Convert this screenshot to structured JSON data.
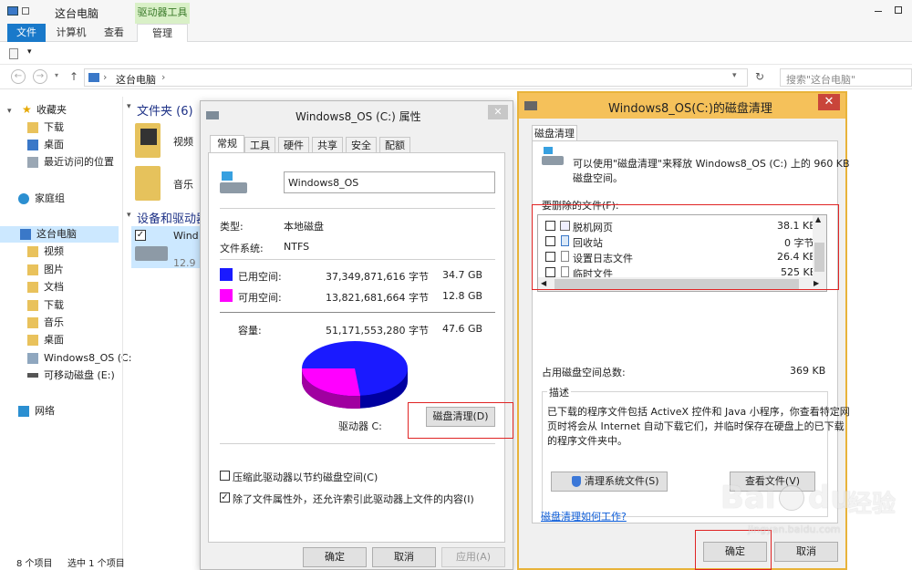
{
  "explorer": {
    "title": "这台电脑",
    "context_tab": "驱动器工具",
    "tabs": {
      "file": "文件",
      "computer": "计算机",
      "view": "查看",
      "manage": "管理"
    },
    "address_path": "这台电脑",
    "search_placeholder": "搜索\"这台电脑\"",
    "nav": {
      "favorites": "收藏夹",
      "downloads": "下载",
      "desktop": "桌面",
      "recent": "最近访问的位置",
      "homegroup": "家庭组",
      "this_pc": "这台电脑",
      "videos": "视频",
      "pictures": "图片",
      "documents": "文档",
      "downloads2": "下载",
      "music": "音乐",
      "desktop2": "桌面",
      "drive_c": "Windows8_OS (C:",
      "removable": "可移动磁盘 (E:)",
      "network": "网络"
    },
    "content": {
      "folders_header": "文件夹 (6)",
      "video_folder": "视频",
      "music_folder": "音乐",
      "devices_header": "设备和驱动器",
      "drive_name_partial": "Wind",
      "drive_size_partial": "12.9"
    },
    "status": {
      "items": "8 个项目",
      "selected": "选中 1 个项目"
    }
  },
  "properties": {
    "title": "Windows8_OS (C:) 属性",
    "tabs": [
      "常规",
      "工具",
      "硬件",
      "共享",
      "安全",
      "配额"
    ],
    "volume_name": "Windows8_OS",
    "type_label": "类型:",
    "type_value": "本地磁盘",
    "fs_label": "文件系统:",
    "fs_value": "NTFS",
    "used_label": "已用空间:",
    "used_bytes": "37,349,871,616 字节",
    "used_gb": "34.7 GB",
    "free_label": "可用空间:",
    "free_bytes": "13,821,681,664 字节",
    "free_gb": "12.8 GB",
    "capacity_label": "容量:",
    "capacity_bytes": "51,171,553,280 字节",
    "capacity_gb": "47.6 GB",
    "drive_label": "驱动器 C:",
    "cleanup_button": "磁盘清理(D)",
    "compress_label": "压缩此驱动器以节约磁盘空间(C)",
    "index_label": "除了文件属性外，还允许索引此驱动器上文件的内容(I)",
    "ok": "确定",
    "cancel": "取消",
    "apply": "应用(A)",
    "colors": {
      "used": "#1a1aff",
      "free": "#ff00ff"
    }
  },
  "cleanup": {
    "title": "Windows8_OS(C:)的磁盘清理",
    "tab": "磁盘清理",
    "intro_line1": "可以使用\"磁盘清理\"来释放 Windows8_OS (C:) 上的 960 KB",
    "intro_line2": "磁盘空间。",
    "files_label": "要删除的文件(F):",
    "files": [
      {
        "name": "脱机网页",
        "size": "38.1 KB"
      },
      {
        "name": "回收站",
        "size": "0 字节"
      },
      {
        "name": "设置日志文件",
        "size": "26.4 KB"
      },
      {
        "name": "临时文件",
        "size": "525 KB"
      }
    ],
    "total_label": "占用磁盘空间总数:",
    "total_value": "369 KB",
    "desc_title": "描述",
    "desc_line1": "已下载的程序文件包括 ActiveX 控件和 Java 小程序，你查看特定网",
    "desc_line2": "页时将会从 Internet 自动下载它们，并临时保存在硬盘上的已下载",
    "desc_line3": "的程序文件夹中。",
    "clean_system_button": "清理系统文件(S)",
    "view_files_button": "查看文件(V)",
    "help_link": "磁盘清理如何工作?",
    "ok": "确定",
    "cancel": "取消",
    "close": "✕"
  },
  "watermark": {
    "brand": "Bai",
    "brand2": "du",
    "suffix": "经验",
    "url": "jingyan.baidu.com"
  }
}
